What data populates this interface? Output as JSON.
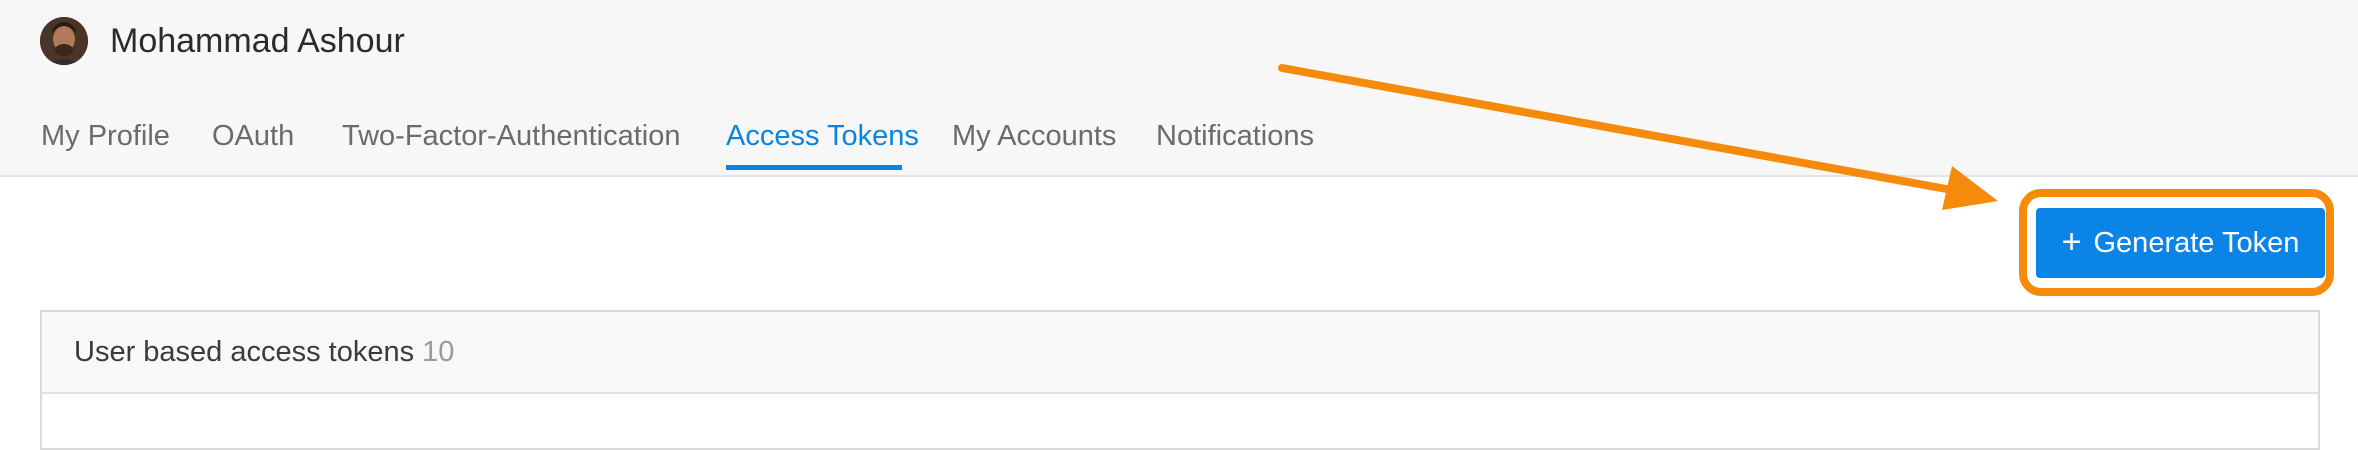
{
  "user": {
    "name": "Mohammad Ashour"
  },
  "tabs": [
    {
      "label": "My Profile",
      "active": false
    },
    {
      "label": "OAuth",
      "active": false
    },
    {
      "label": "Two-Factor-Authentication",
      "active": false
    },
    {
      "label": "Access Tokens",
      "active": true
    },
    {
      "label": "My Accounts",
      "active": false
    },
    {
      "label": "Notifications",
      "active": false
    }
  ],
  "actions": {
    "generate_icon": "+",
    "generate_label": "Generate Token"
  },
  "panel": {
    "title": "User based access tokens",
    "count": "10"
  },
  "colors": {
    "accent": "#0a84e0",
    "button": "#0b84e8",
    "annotation": "#f58a0b"
  },
  "annotations": {
    "arrow_icon": "arrow-icon",
    "highlight": "highlight-box"
  }
}
